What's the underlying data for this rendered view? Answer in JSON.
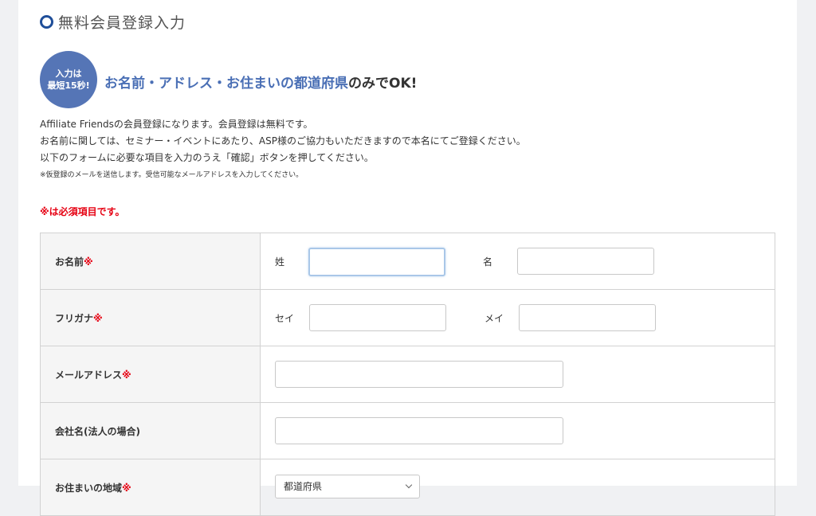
{
  "section_title": "無料会員登録入力",
  "badge": {
    "line1": "入力は",
    "line2": "最短15秒!"
  },
  "headline": {
    "blue_part": "お名前・アドレス・お住まいの都道府県",
    "dark_part": "のみで",
    "ok": "OK!"
  },
  "intro": [
    "Affiliate Friendsの会員登録になります。会員登録は無料です。",
    "お名前に関しては、セミナー・イベントにあたり、ASP様のご協力もいただきますので本名にてご登録ください。",
    "以下のフォームに必要な項目を入力のうえ「確認」ボタンを押してください。"
  ],
  "intro_small": "※仮登録のメールを送信します。受信可能なメールアドレスを入力してください。",
  "required_note": "※は必須項目です。",
  "rows": {
    "name": {
      "label": "お名前",
      "required_mark": "※",
      "last_label": "姓",
      "first_label": "名",
      "last_value": "",
      "first_value": ""
    },
    "kana": {
      "label": "フリガナ",
      "required_mark": "※",
      "last_label": "セイ",
      "first_label": "メイ",
      "last_value": "",
      "first_value": ""
    },
    "email": {
      "label": "メールアドレス",
      "required_mark": "※",
      "value": ""
    },
    "company": {
      "label": "会社名(法人の場合)",
      "value": ""
    },
    "region": {
      "label": "お住まいの地域",
      "required_mark": "※",
      "select_value": "都道府県"
    }
  }
}
